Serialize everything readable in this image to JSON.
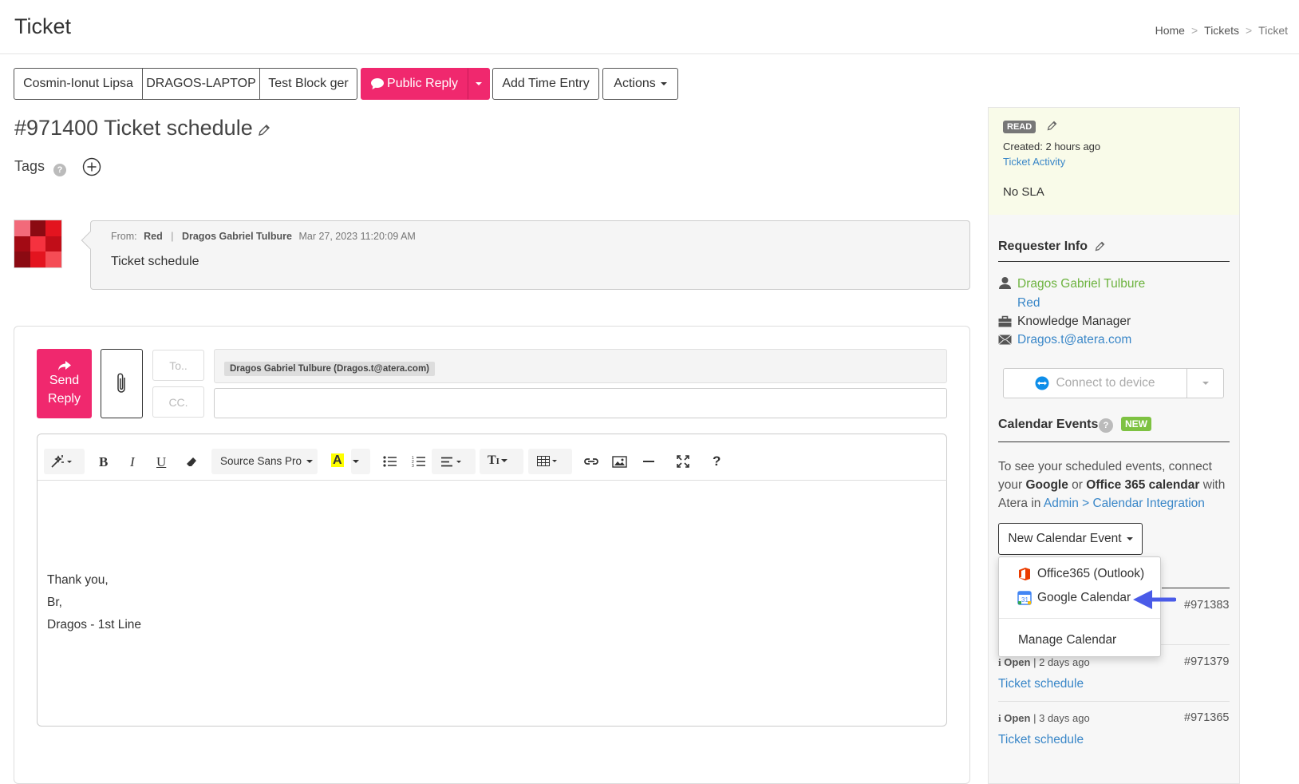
{
  "header": {
    "title": "Ticket",
    "breadcrumbs": [
      "Home",
      "Tickets",
      "Ticket"
    ]
  },
  "toolbar": {
    "contact_label": "Cosmin-Ionut Lipsa",
    "device_label": "DRAGOS-LAPTOP",
    "site_label": "Test Block ger",
    "public_reply_label": "Public Reply",
    "add_time_entry_label": "Add Time Entry",
    "actions_label": "Actions"
  },
  "ticket": {
    "title": "#971400 Ticket schedule",
    "tags_label": "Tags"
  },
  "message": {
    "from_label": "From:",
    "from_customer": "Red",
    "from_name": "Dragos Gabriel Tulbure",
    "timestamp": "Mar 27, 2023 11:20:09 AM",
    "body": "Ticket schedule"
  },
  "reply": {
    "send_label_1": "Send",
    "send_label_2": "Reply",
    "to_label": "To..",
    "cc_label": "CC.",
    "recipient_chip": "Dragos Gabriel Tulbure (Dragos.t@atera.com)",
    "font_name": "Source Sans Pro",
    "signature": [
      "Thank you,",
      "Br,",
      "Dragos - 1st Line"
    ]
  },
  "sidebar": {
    "status_badge": "READ",
    "created": "Created: 2 hours ago",
    "activity_link": "Ticket Activity",
    "sla": "No SLA",
    "requester_heading": "Requester Info",
    "requester_name": "Dragos Gabriel Tulbure",
    "requester_company": "Red",
    "requester_role": "Knowledge Manager",
    "requester_email": "Dragos.t@atera.com",
    "connect_label": "Connect to device",
    "calendar_heading": "Calendar Events",
    "new_badge": "NEW",
    "calendar_text_1": "To see your scheduled events, connect",
    "calendar_text_2a": "your ",
    "calendar_text_2b": "Google",
    "calendar_text_2c": " or ",
    "calendar_text_2d": "Office 365 calendar",
    "calendar_text_2e": " with",
    "calendar_text_3a": "Atera in ",
    "calendar_link": "Admin > Calendar Integration",
    "new_event_label": "New Calendar Event",
    "dropdown": {
      "office": "Office365 (Outlook)",
      "google": "Google Calendar",
      "manage": "Manage Calendar"
    },
    "related": [
      {
        "status": "Open",
        "age": "| 2 days ago",
        "id": "#971379",
        "title": "Ticket schedule"
      },
      {
        "status": "Open",
        "age": "| 3 days ago",
        "id": "#971365",
        "title": "Ticket schedule"
      }
    ],
    "partial_id": "#971383"
  },
  "colors": {
    "accent_pink": "#f0286e",
    "link_blue": "#3a87c8",
    "requester_green": "#6db33f",
    "arrow_blue": "#4a5be8"
  }
}
